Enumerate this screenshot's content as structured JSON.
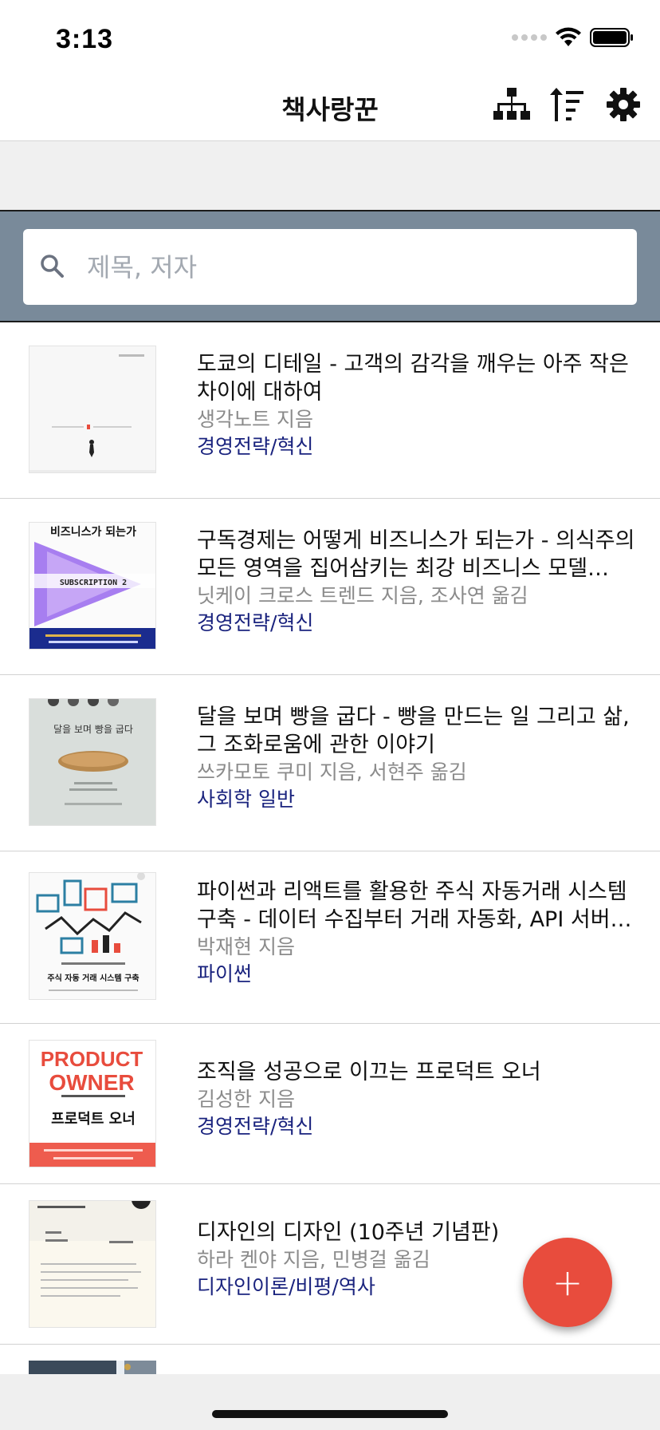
{
  "status_bar": {
    "time": "3:13"
  },
  "nav": {
    "title": "책사랑꾼",
    "icons": [
      "hierarchy-icon",
      "sort-icon",
      "gear-icon"
    ]
  },
  "search": {
    "placeholder": "제목, 저자",
    "value": ""
  },
  "books": [
    {
      "title": "도쿄의 디테일 - 고객의 감각을 깨우는 아주 작은 차이에 대하여",
      "author": "생각노트 지음",
      "category": "경영전략/혁신"
    },
    {
      "title": "구독경제는 어떻게 비즈니스가 되는가 - 의식주의 모든 영역을 집어삼키는 최강 비즈니스 모델…",
      "author": "닛케이 크로스 트렌드 지음, 조사연 옮김",
      "category": "경영전략/혁신",
      "cover_text": [
        "비즈니스가 되는가",
        "SUBSCRIPTION 2"
      ]
    },
    {
      "title": "달을 보며 빵을 굽다 - 빵을 만드는 일 그리고 삶, 그 조화로움에 관한 이야기",
      "author": "쓰카모토 쿠미 지음, 서현주 옮김",
      "category": "사회학 일반",
      "cover_text": [
        "달을 보며 빵을 굽다"
      ]
    },
    {
      "title": "파이썬과 리액트를 활용한 주식 자동거래 시스템 구축 - 데이터 수집부터 거래 자동화, API 서버…",
      "author": "박재현 지음",
      "category": "파이썬",
      "cover_text": [
        "주식 자동 거래 시스템 구축"
      ]
    },
    {
      "title": "조직을 성공으로 이끄는 프로덕트 오너",
      "author": "김성한 지음",
      "category": "경영전략/혁신",
      "cover_text": [
        "PRODUCT",
        "OWNER",
        "프로덕트 오너"
      ]
    },
    {
      "title": "디자인의 디자인 (10주년 기념판)",
      "author": "하라 켄야 지음, 민병걸 옮김",
      "category": "디자인이론/비평/역사"
    }
  ],
  "fab": {
    "label": "+"
  },
  "colors": {
    "accent": "#e84c3d",
    "category": "#1a237e",
    "search_band": "#798a9a"
  }
}
